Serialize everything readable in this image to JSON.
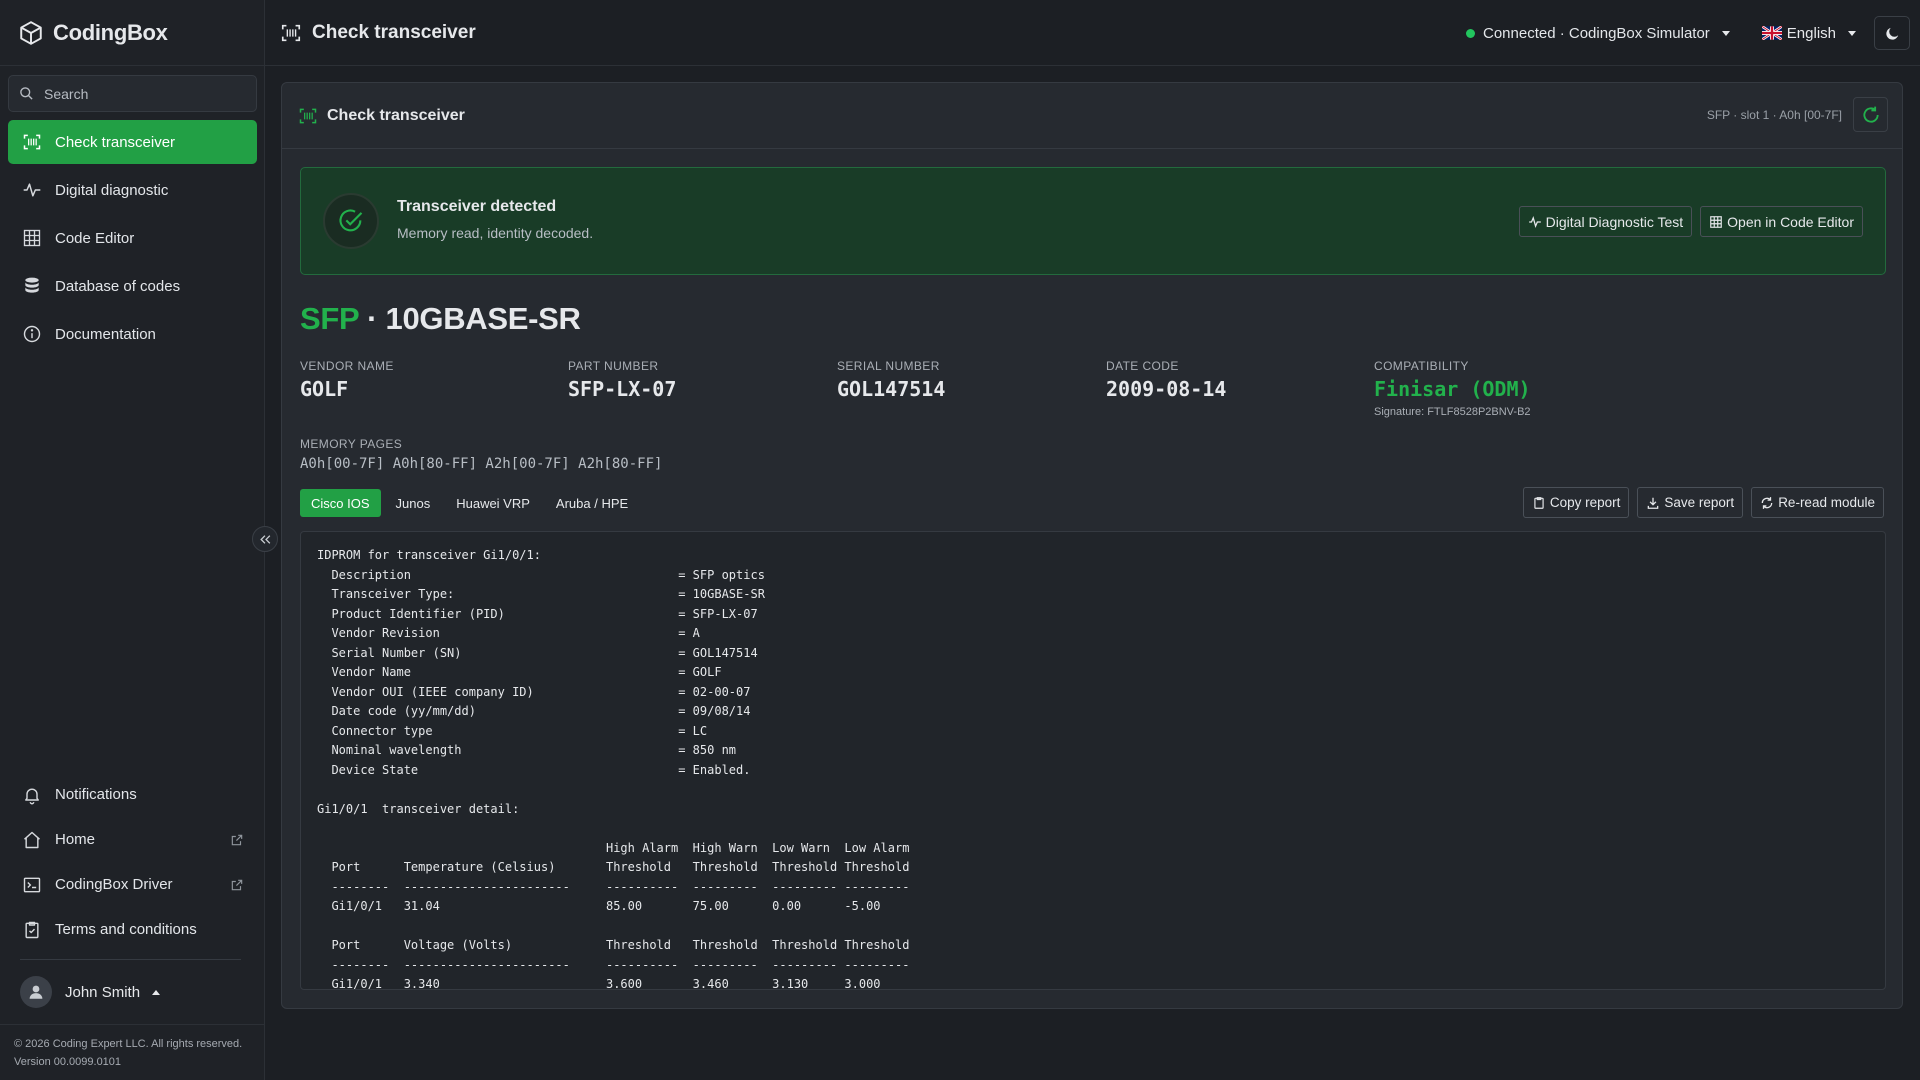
{
  "app": {
    "name": "CodingBox"
  },
  "search": {
    "placeholder": "Search"
  },
  "sidebar": {
    "items": [
      {
        "label": "Check transceiver",
        "icon": "barcode-scan-icon",
        "active": true
      },
      {
        "label": "Digital diagnostic",
        "icon": "pulse-icon"
      },
      {
        "label": "Code Editor",
        "icon": "grid-icon"
      },
      {
        "label": "Database of codes",
        "icon": "database-icon"
      },
      {
        "label": "Documentation",
        "icon": "info-icon"
      }
    ],
    "bottom_items": [
      {
        "label": "Notifications",
        "icon": "bell-icon"
      },
      {
        "label": "Home",
        "icon": "home-icon",
        "external": true
      },
      {
        "label": "CodingBox Driver",
        "icon": "terminal-icon",
        "external": true
      },
      {
        "label": "Terms and conditions",
        "icon": "clipboard-check-icon"
      }
    ],
    "user": {
      "name": "John Smith"
    },
    "footer": {
      "copyright": "© 2026 Coding Expert LLC. All rights reserved.",
      "version": "Version 00.0099.0101"
    }
  },
  "header": {
    "title": "Check transceiver",
    "connection": "Connected · CodingBox Simulator",
    "connection_color": "#22c55e",
    "language": "English"
  },
  "panel": {
    "title": "Check transceiver",
    "slot": "SFP · slot 1 · A0h [00-7F]",
    "alert": {
      "title": "Transceiver detected",
      "subtitle": "Memory read, identity decoded.",
      "buttons": [
        "Digital Diagnostic Test",
        "Open in Code Editor"
      ]
    },
    "module_type": "SFP",
    "separator": " · ",
    "module_name": "10GBASE-SR",
    "fields": [
      {
        "label": "VENDOR NAME",
        "value": "GOLF"
      },
      {
        "label": "PART NUMBER",
        "value": "SFP-LX-07"
      },
      {
        "label": "SERIAL NUMBER",
        "value": "GOL147514"
      },
      {
        "label": "DATE CODE",
        "value": "2009-08-14"
      },
      {
        "label": "COMPATIBILITY",
        "value": "Finisar (ODM)",
        "signature": "Signature: FTLF8528P2BNV-B2"
      }
    ],
    "memory_pages": {
      "label": "MEMORY PAGES",
      "value": "A0h[00-7F] A0h[80-FF] A2h[00-7F] A2h[80-FF]"
    },
    "tabs": [
      "Cisco IOS",
      "Junos",
      "Huawei VRP",
      "Aruba / HPE"
    ],
    "active_tab": "Cisco IOS",
    "report_buttons": [
      "Copy report",
      "Save report",
      "Re-read module"
    ],
    "report_text": "IDPROM for transceiver Gi1/0/1:\n  Description                                     = SFP optics\n  Transceiver Type:                               = 10GBASE-SR\n  Product Identifier (PID)                        = SFP-LX-07\n  Vendor Revision                                 = A\n  Serial Number (SN)                              = GOL147514\n  Vendor Name                                     = GOLF\n  Vendor OUI (IEEE company ID)                    = 02-00-07\n  Date code (yy/mm/dd)                            = 09/08/14\n  Connector type                                  = LC\n  Nominal wavelength                              = 850 nm\n  Device State                                    = Enabled.\n\nGi1/0/1  transceiver detail:\n\n                                        High Alarm  High Warn  Low Warn  Low Alarm\n  Port      Temperature (Celsius)       Threshold   Threshold  Threshold Threshold\n  --------  -----------------------     ----------  ---------  --------- ---------\n  Gi1/0/1   31.04                       85.00       75.00      0.00      -5.00\n\n  Port      Voltage (Volts)             Threshold   Threshold  Threshold Threshold\n  --------  -----------------------     ----------  ---------  --------- ---------\n  Gi1/0/1   3.340                       3.600       3.460      3.130     3.000"
  },
  "colors": {
    "accent": "#22a045",
    "alert_bg": "#193c27",
    "background": "#1c1f24"
  }
}
